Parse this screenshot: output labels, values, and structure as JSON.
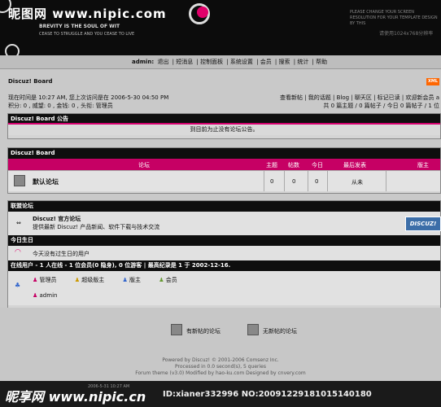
{
  "header": {
    "logo_text": "昵图网 www.nipic.com",
    "tagline1": "BREVITY IS THE SOUL OF WIT",
    "tagline2": "CEASE TO STRUGGLE AND YOU CEASE TO LIVE",
    "note_right": "PLEASE CHANGE YOUR SCREEN RESOLUTION FOR YOUR TEMPLATE DESIGN BY THIS",
    "note_right2": "请使用1024x768分辨率"
  },
  "nav": {
    "user": "admin:",
    "items": [
      "退出",
      "短消息",
      "控制面板",
      "系统设置",
      "会员",
      "搜索",
      "统计",
      "帮助"
    ]
  },
  "board": {
    "title": "Discuz! Board",
    "xml": "XML",
    "info_line1": "现在时间是 10:27 AM, 您上次访问是在 2006-5-30 04:50 PM",
    "info_line2": "积分: 0 , 威望: 0 , 金钱: 0 , 头衔: 管理员",
    "links_line1": "查看新帖 | 我的话题 | Blog | 聊天区 | 标记已读 | 欢迎新会员 a",
    "links_line2": "共 0 篇主题 / 0 篇帖子 / 今日 0 篇帖子 / 1 位"
  },
  "announcement": {
    "title": "Discuz! Board 公告",
    "text": "到目前为止没有论坛公告。"
  },
  "forum_section": {
    "title": "Discuz! Board",
    "headers": {
      "forum": "论坛",
      "topics": "主题",
      "posts": "帖数",
      "today": "今日",
      "lastpost": "最后发表",
      "moderator": "版主"
    },
    "rows": [
      {
        "name": "默认论坛",
        "topics": "0",
        "posts": "0",
        "today": "0",
        "lastpost": "从未",
        "moderator": ""
      }
    ]
  },
  "links_section": {
    "title": "联盟论坛",
    "name": "Discuz! 官方论坛",
    "desc": "提供最新 Discuz! 产品新闻、软件下载与技术交流",
    "banner": "DISCUZ!"
  },
  "birthday": {
    "title": "今日生日",
    "text": "今天没有过生日的用户"
  },
  "online": {
    "title": "在线用户 - 1 人在线 - 1 位会员(0 隐身), 0 位游客 | 最高纪录是 1 于 2002-12-16.",
    "legend": [
      "管理员",
      "超级版主",
      "版主",
      "会员"
    ],
    "users": [
      "admin"
    ]
  },
  "footer": {
    "new_posts": "有新帖的论坛",
    "no_new_posts": "无新帖的论坛",
    "powered1": "Powered by Discuz! © 2001-2006 Comsenz Inc.",
    "powered2": "Processed in 0.0 second(s), 5 queries",
    "powered3": "Forum theme (v3.0) Modified by hao-ku.com Designed by cnvery.com"
  },
  "bottom_bar": {
    "watermark": "昵享网 www.nipic.cn",
    "time": "2006-5-31 10:27 AM",
    "id": "ID:xianer332996 NO:20091229181015140180"
  }
}
